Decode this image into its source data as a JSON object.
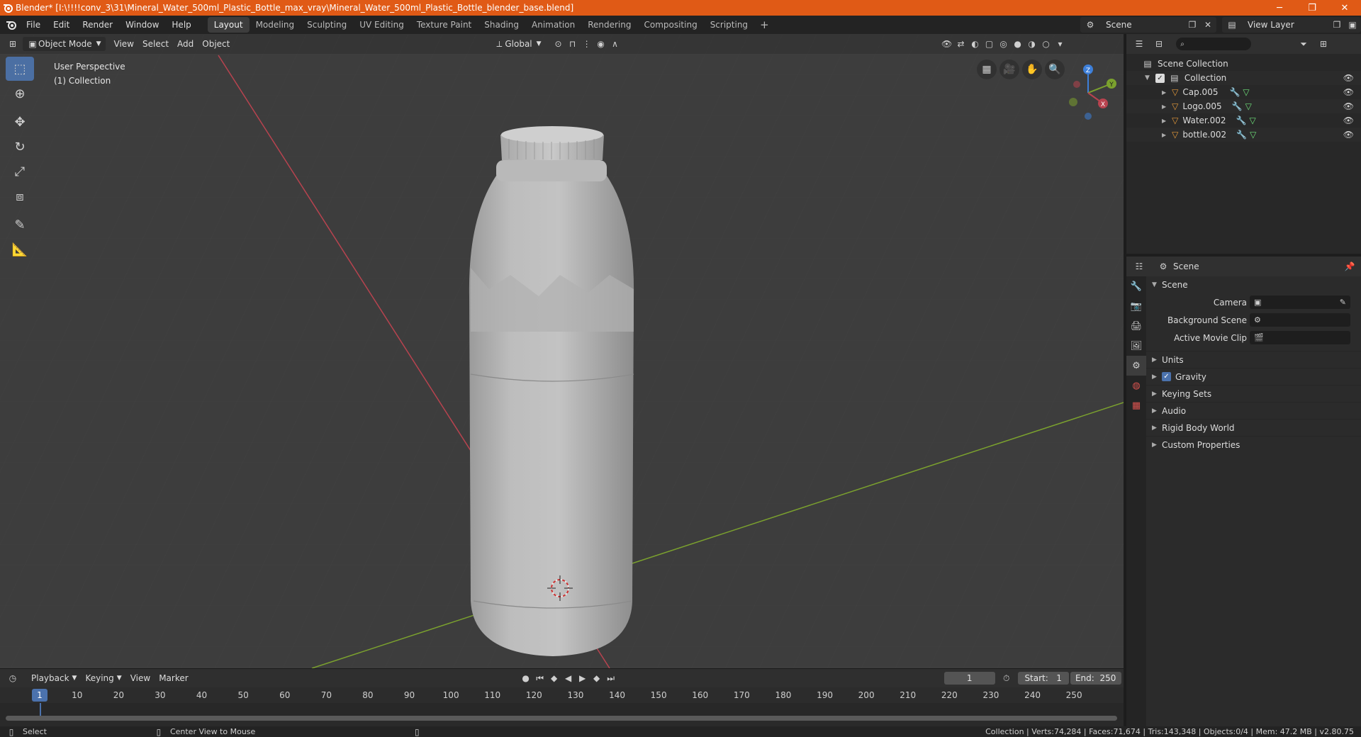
{
  "window": {
    "title": "Blender* [I:\\!!!!conv_3\\31\\Mineral_Water_500ml_Plastic_Bottle_max_vray\\Mineral_Water_500ml_Plastic_Bottle_blender_base.blend]",
    "controls": [
      "─",
      "❐",
      "✕"
    ]
  },
  "menubar": {
    "menus": [
      "File",
      "Edit",
      "Render",
      "Window",
      "Help"
    ],
    "workspaces": [
      "Layout",
      "Modeling",
      "Sculpting",
      "UV Editing",
      "Texture Paint",
      "Shading",
      "Animation",
      "Rendering",
      "Compositing",
      "Scripting"
    ],
    "active_workspace": "Layout",
    "add_tab": "+",
    "scene": "Scene",
    "view_layer": "View Layer"
  },
  "viewport": {
    "mode": "Object Mode",
    "menus": [
      "View",
      "Select",
      "Add",
      "Object"
    ],
    "transform_orientation": "Global",
    "overlay_line1": "User Perspective",
    "overlay_line2": "(1) Collection",
    "gizmo_axes": {
      "z": "Z",
      "y": "Y",
      "x": "X"
    },
    "colors": {
      "x_axis": "#b8434f",
      "y_axis": "#7ba12e",
      "z_axis": "#3d7fd9",
      "background": "#3d3d3d"
    }
  },
  "timeline": {
    "menus": [
      "Playback",
      "Keying",
      "View",
      "Marker"
    ],
    "current_frame": "1",
    "start_label": "Start:",
    "start": "1",
    "end_label": "End:",
    "end": "250",
    "ticks": [
      "1",
      "10",
      "20",
      "30",
      "40",
      "50",
      "60",
      "70",
      "80",
      "90",
      "100",
      "110",
      "120",
      "130",
      "140",
      "150",
      "160",
      "170",
      "180",
      "190",
      "200",
      "210",
      "220",
      "230",
      "240",
      "250"
    ]
  },
  "statusbar": {
    "left_action": "Select",
    "middle_action": "Center View to Mouse",
    "stats": "Collection | Verts:74,284 | Faces:71,674 | Tris:143,348 | Objects:0/4 | Mem: 47.2 MB | v2.80.75"
  },
  "outliner": {
    "root": "Scene Collection",
    "collection": "Collection",
    "objects": [
      "Cap.005",
      "Logo.005",
      "Water.002",
      "bottle.002"
    ]
  },
  "properties": {
    "context": "Scene",
    "panel": "Scene",
    "fields": [
      {
        "label": "Camera",
        "value": ""
      },
      {
        "label": "Background Scene",
        "value": ""
      },
      {
        "label": "Active Movie Clip",
        "value": ""
      }
    ],
    "subpanels": [
      "Units",
      "Gravity",
      "Keying Sets",
      "Audio",
      "Rigid Body World",
      "Custom Properties"
    ],
    "gravity_enabled": true
  }
}
